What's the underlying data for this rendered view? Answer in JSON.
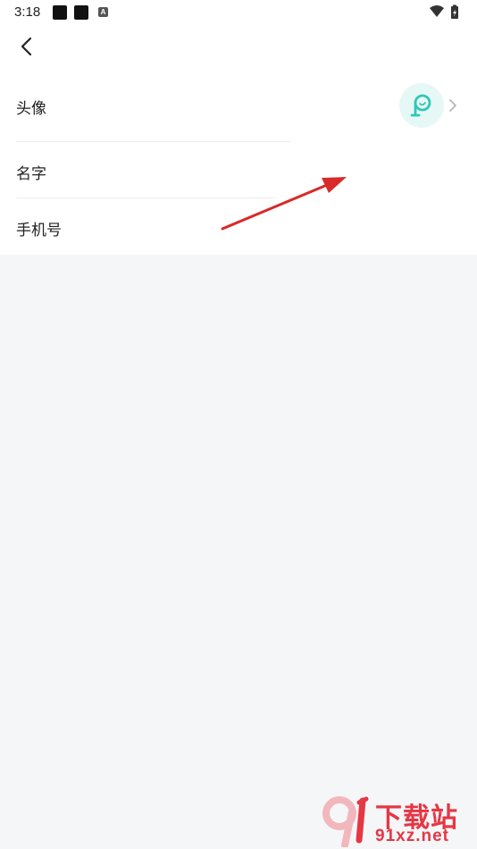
{
  "status_bar": {
    "time": "3:18",
    "notification_badge": "A",
    "icons": [
      "wifi-icon",
      "battery-icon"
    ]
  },
  "toolbar": {
    "back_icon": "chevron-left-icon"
  },
  "profile_rows": [
    {
      "label": "头像",
      "value": "",
      "icon": "avatar-icon",
      "has_chevron": true
    },
    {
      "label": "名字",
      "value": ""
    },
    {
      "label": "手机号",
      "value": ""
    }
  ],
  "colors": {
    "page_background": "#f5f6f8",
    "card_background": "#ffffff",
    "avatar_bg": "#e6f8f6",
    "avatar_accent": "#2fc7b6",
    "annotation_arrow": "#d92a2a",
    "watermark": "#e53744"
  },
  "watermark": {
    "cn_text": "下载站",
    "en_text": "91xz.net"
  }
}
